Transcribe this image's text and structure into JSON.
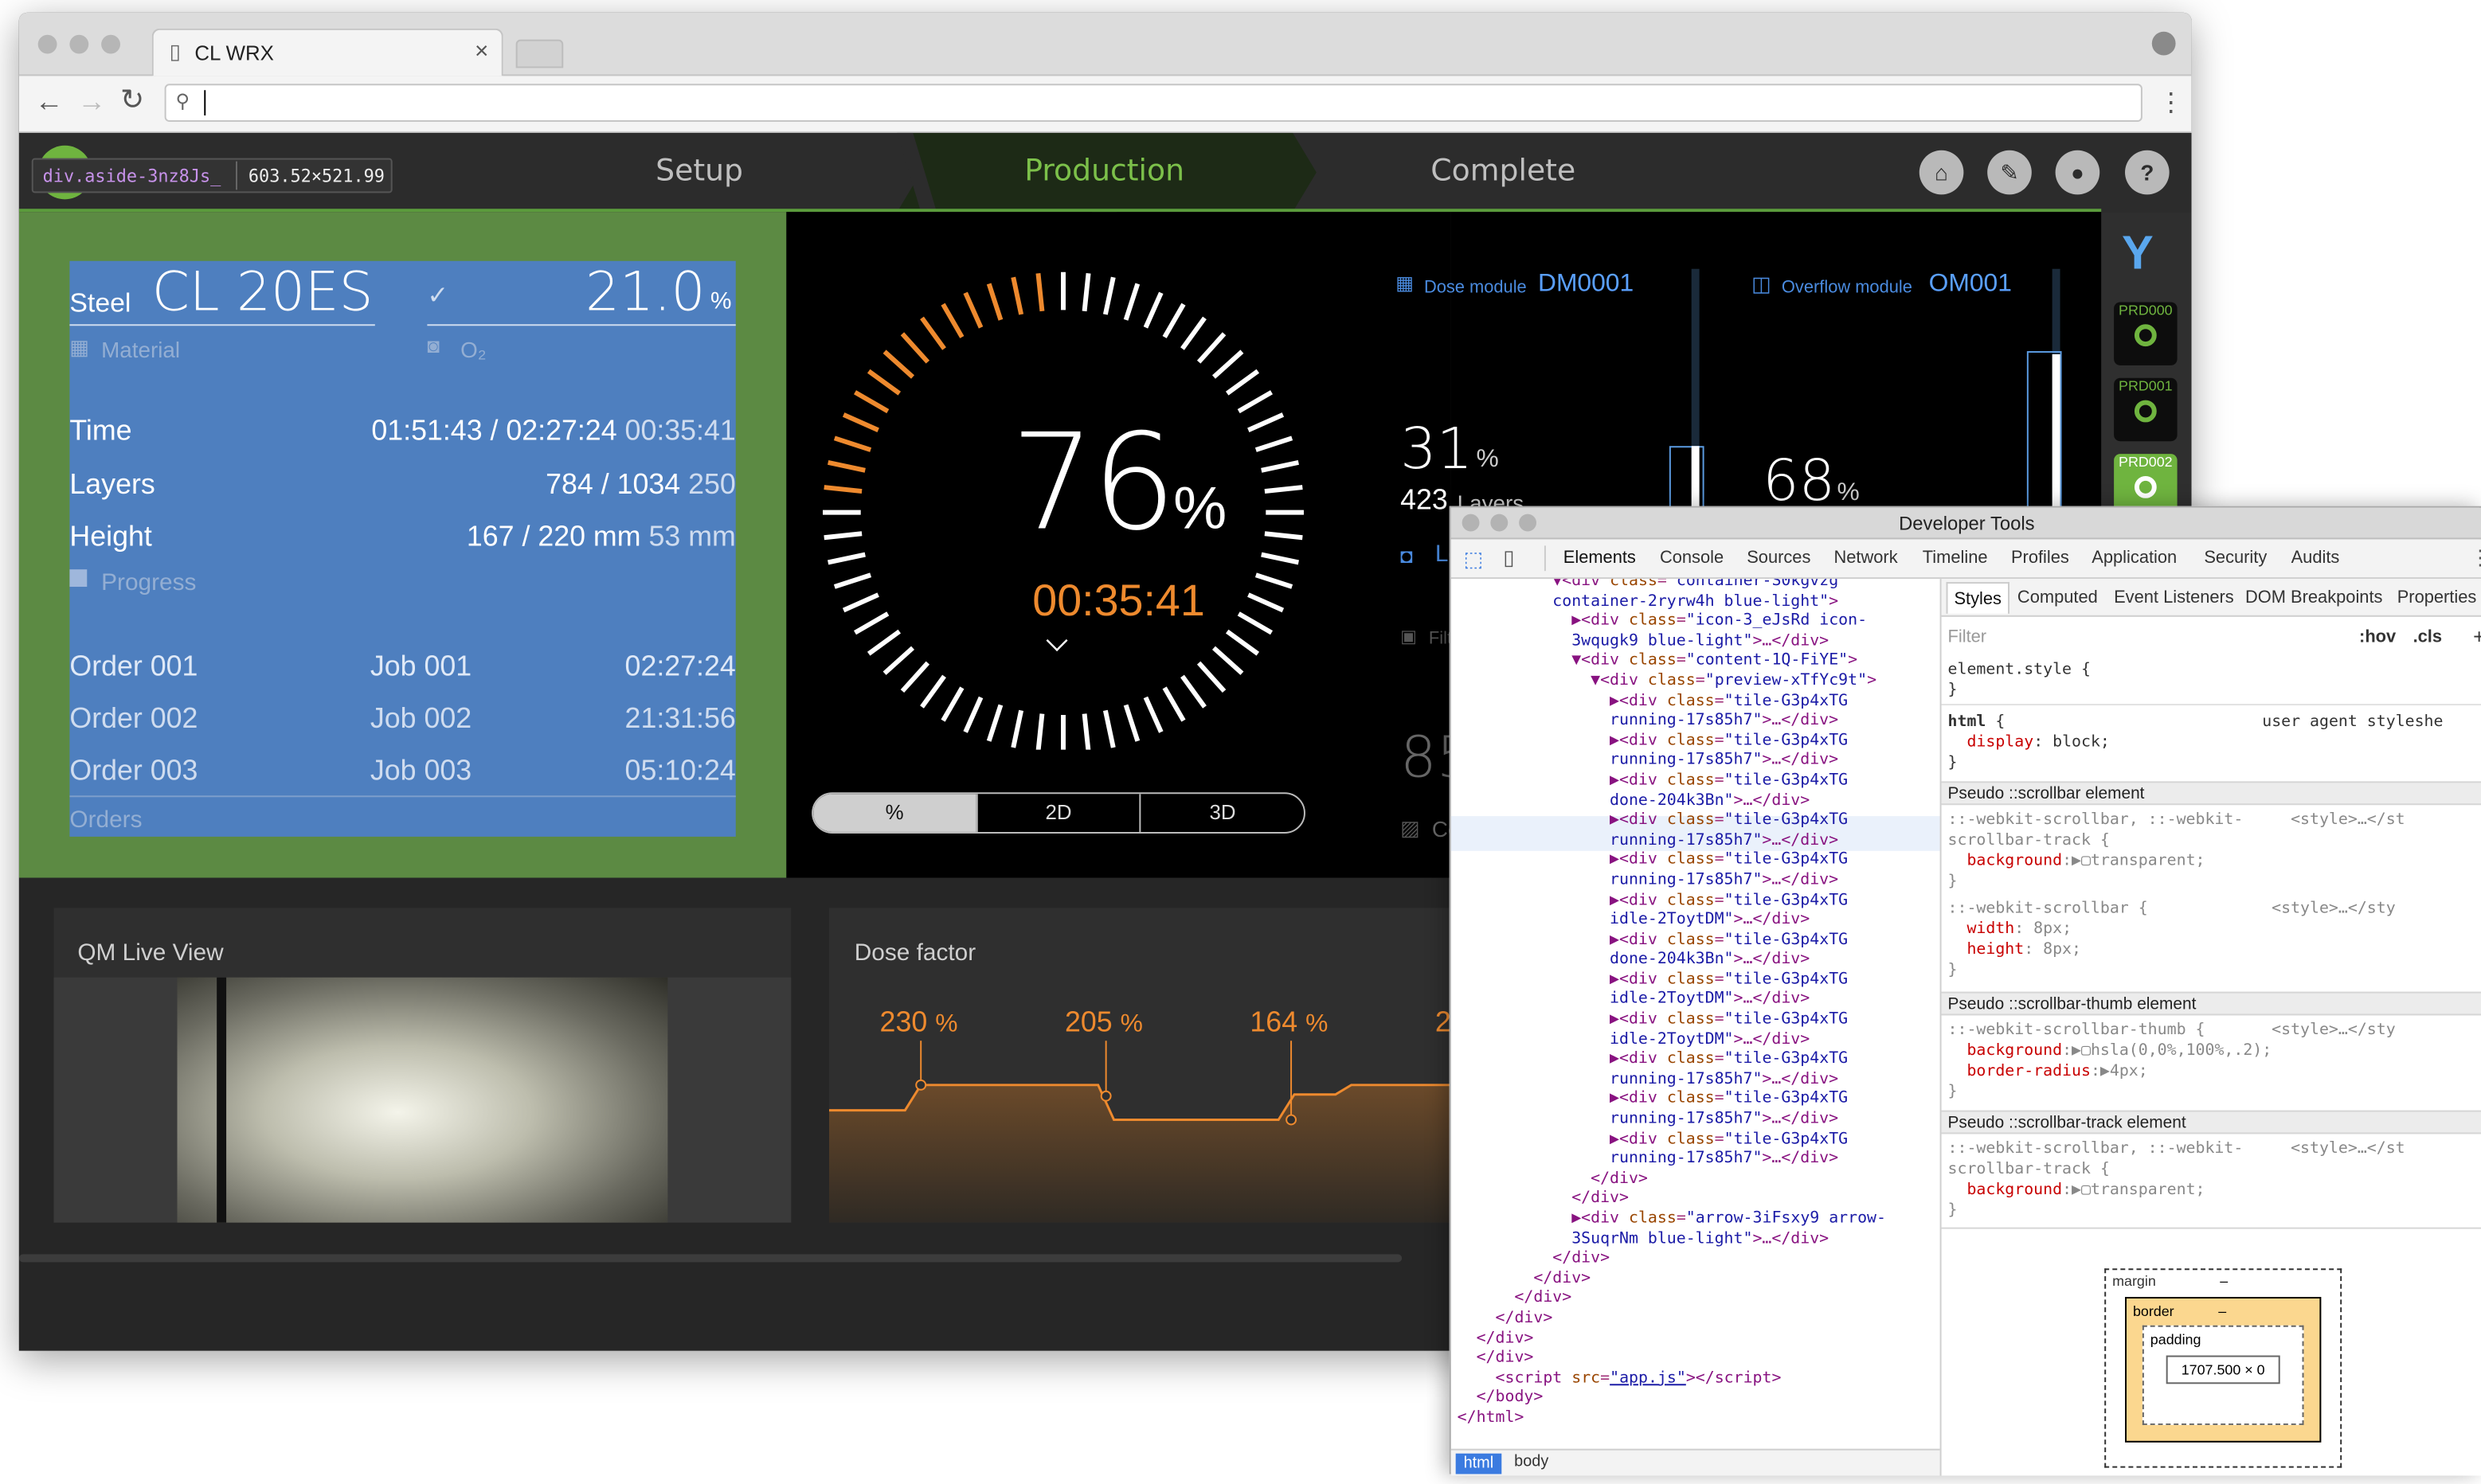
{
  "browser": {
    "tab_title": "CL WRX",
    "address": ""
  },
  "inspect_tooltip": {
    "selector": "div.aside-3nz8Js_",
    "size": "603.52×521.99"
  },
  "nav": {
    "setup": "Setup",
    "production": "Production",
    "complete": "Complete"
  },
  "material": {
    "label": "Steel",
    "value": "CL 20ES",
    "sub": "Material",
    "o2_value": "21.0",
    "o2_unit": "%",
    "o2_label": "O₂"
  },
  "stats": [
    {
      "label": "Time",
      "value": "01:51:43 / 02:27:24",
      "extra": "00:35:41"
    },
    {
      "label": "Layers",
      "value": "784 / 1034",
      "extra": "250"
    },
    {
      "label": "Height",
      "value": "167 / 220 mm",
      "extra": "53 mm"
    }
  ],
  "progress_label": "Progress",
  "orders": [
    {
      "order": "Order 001",
      "job": "Job 001",
      "time": "02:27:24"
    },
    {
      "order": "Order 002",
      "job": "Job 002",
      "time": "21:31:56"
    },
    {
      "order": "Order 003",
      "job": "Job 003",
      "time": "05:10:24"
    }
  ],
  "orders_label": "Orders",
  "gauge": {
    "value": "76",
    "unit": "%",
    "time": "00:35:41",
    "progress": 0.76
  },
  "view_toggle": [
    "%",
    "2D",
    "3D"
  ],
  "dose": {
    "label": "Dose module",
    "id": "DM0001",
    "percent": "31",
    "unit": "%",
    "layers": "423",
    "layers_label": "Layers",
    "level_label": "Lev",
    "filter_label": "Filte",
    "big": "85",
    "co_label": "Co"
  },
  "overflow": {
    "label": "Overflow module",
    "id": "OM001",
    "percent": "68",
    "unit": "%"
  },
  "machines": [
    "PRD000",
    "PRD001",
    "PRD002"
  ],
  "qm": {
    "title": "QM Live View"
  },
  "dosefactor": {
    "title": "Dose factor",
    "values": [
      "230",
      "205",
      "164",
      "2"
    ],
    "unit": "%"
  },
  "devtools": {
    "title": "Developer Tools",
    "tabs": [
      "Elements",
      "Console",
      "Sources",
      "Network",
      "Timeline",
      "Profiles",
      "Application",
      "Security",
      "Audits"
    ],
    "style_tabs": [
      "Styles",
      "Computed",
      "Event Listeners",
      "DOM Breakpoints",
      "Properties"
    ],
    "filter": "Filter",
    "hov": ":hov",
    ".cls": ".cls",
    "breadcrumb": [
      "html",
      "body"
    ],
    "box_labels": {
      "margin": "margin",
      "border": "border",
      "padding": "padding",
      "content": "1707.500 × 0",
      "dash": "–"
    }
  }
}
